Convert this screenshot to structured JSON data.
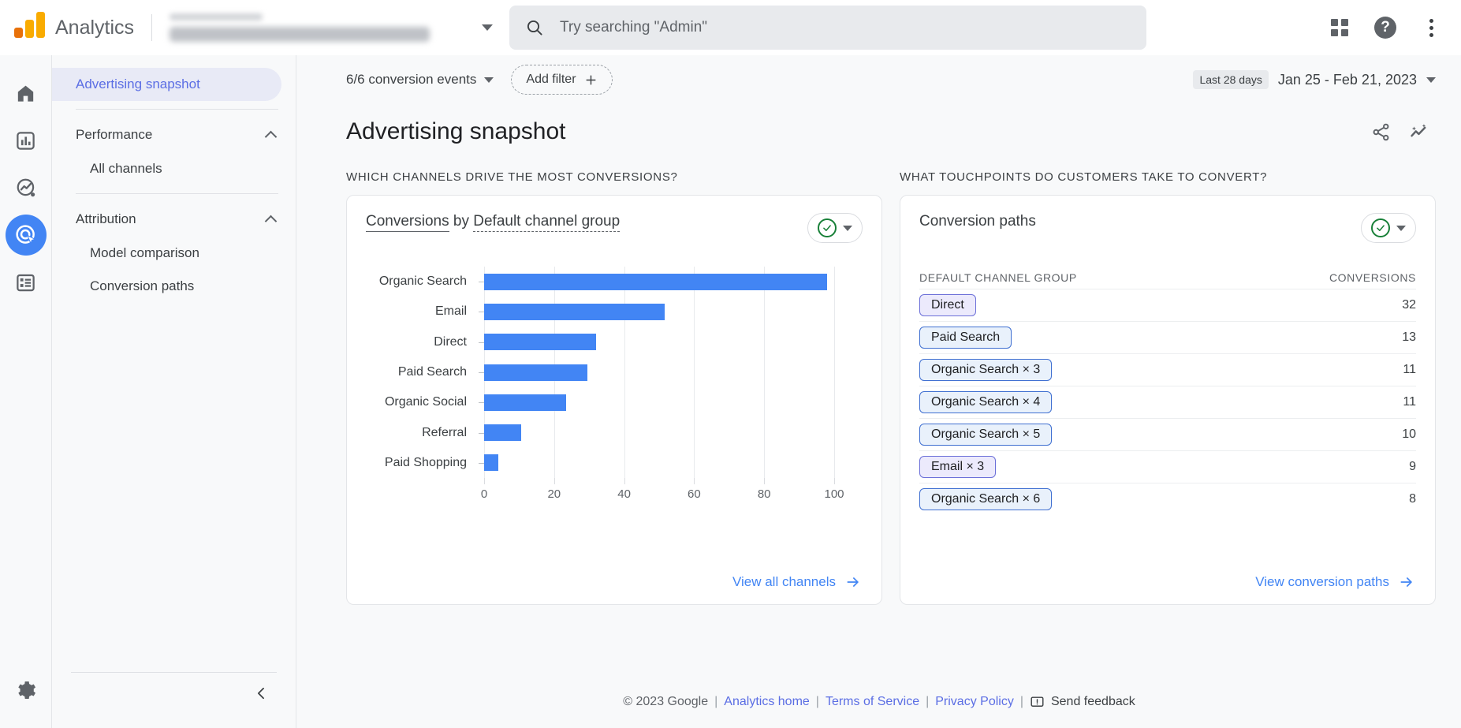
{
  "topbar": {
    "brand": "Analytics",
    "logo_icon": "analytics-logo-icon",
    "property_selector_icon": "chevron-down-icon",
    "search": {
      "placeholder": "Try searching \"Admin\"",
      "value": "",
      "icon": "search-icon"
    },
    "apps_icon": "apps-grid-icon",
    "help_icon": "help-icon",
    "help_glyph": "?",
    "more_icon": "more-vert-icon"
  },
  "rail": {
    "items": [
      {
        "icon": "home-icon",
        "label": "Home",
        "active": false
      },
      {
        "icon": "reports-bar-chart-icon",
        "label": "Reports",
        "active": false
      },
      {
        "icon": "explore-trending-icon",
        "label": "Explore",
        "active": false
      },
      {
        "icon": "advertising-target-icon",
        "label": "Advertising",
        "active": true
      },
      {
        "icon": "library-list-icon",
        "label": "Library",
        "active": false
      }
    ],
    "settings_icon": "gear-icon"
  },
  "sidebar": {
    "selected": "Advertising snapshot",
    "snapshot_label": "Advertising snapshot",
    "groups": [
      {
        "label": "Performance",
        "chevron": "chevron-up-icon",
        "items": [
          {
            "label": "All channels"
          }
        ]
      },
      {
        "label": "Attribution",
        "chevron": "chevron-up-icon",
        "items": [
          {
            "label": "Model comparison"
          },
          {
            "label": "Conversion paths"
          }
        ]
      }
    ],
    "collapse_icon": "chevron-left-icon"
  },
  "filterbar": {
    "conversion_events": "6/6 conversion events",
    "conversion_events_icon": "chevron-down-icon",
    "add_filter": "Add filter",
    "add_filter_icon": "plus-icon",
    "date_badge": "Last 28 days",
    "date_range": "Jan 25 - Feb 21, 2023",
    "date_icon": "chevron-down-icon"
  },
  "page": {
    "title": "Advertising snapshot",
    "share_icon": "share-icon",
    "insights_icon": "insights-sparkle-icon"
  },
  "left_card": {
    "section_heading": "Which channels drive the most conversions?",
    "title_metric": "Conversions",
    "title_by": "by",
    "title_dimension": "Default channel group",
    "metric_pill_icon": "check-circle-icon",
    "metric_pill_caret": "chevron-down-icon",
    "link_label": "View all channels",
    "link_icon": "arrow-right-icon"
  },
  "right_card": {
    "section_heading": "What touchpoints do customers take to convert?",
    "title": "Conversion paths",
    "metric_pill_icon": "check-circle-icon",
    "metric_pill_caret": "chevron-down-icon",
    "col_dimension": "Default channel group",
    "col_metric": "Conversions",
    "rows": [
      {
        "label": "Direct",
        "value": "32",
        "chip_style": "violet"
      },
      {
        "label": "Paid Search",
        "value": "13",
        "chip_style": "blue"
      },
      {
        "label": "Organic Search × 3",
        "value": "11",
        "chip_style": "blue"
      },
      {
        "label": "Organic Search × 4",
        "value": "11",
        "chip_style": "blue"
      },
      {
        "label": "Organic Search × 5",
        "value": "10",
        "chip_style": "blue"
      },
      {
        "label": "Email × 3",
        "value": "9",
        "chip_style": "violet"
      },
      {
        "label": "Organic Search × 6",
        "value": "8",
        "chip_style": "blue"
      }
    ],
    "link_label": "View conversion paths",
    "link_icon": "arrow-right-icon"
  },
  "footer": {
    "copyright": "© 2023 Google",
    "links": [
      "Analytics home",
      "Terms of Service",
      "Privacy Policy"
    ],
    "feedback": "Send feedback",
    "feedback_icon": "feedback-icon",
    "separator": "|"
  },
  "colors": {
    "accent_blue": "#4285f4",
    "bar_blue": "#4285f4",
    "link_blue": "#5b6ee4",
    "selected_nav_bg": "#e8eaf6",
    "green_check": "#188038",
    "chip_blue_border": "#3f6fd1",
    "chip_blue_fill": "#e9f1fb",
    "chip_violet_border": "#6b6fd8",
    "chip_violet_fill": "#eceafc",
    "page_bg": "#f8f9fa"
  },
  "chart_data": {
    "type": "bar",
    "orientation": "horizontal",
    "title": "Conversions by Default channel group",
    "xlabel": "",
    "ylabel": "",
    "categories": [
      "Organic Search",
      "Email",
      "Direct",
      "Paid Search",
      "Organic Social",
      "Referral",
      "Paid Shopping"
    ],
    "values": [
      98,
      51.5,
      32,
      29.5,
      23.5,
      10.5,
      4
    ],
    "xlim": [
      0,
      100
    ],
    "xticks": [
      0,
      20,
      40,
      60,
      80,
      100
    ],
    "grid": true,
    "legend": false,
    "series": [
      {
        "name": "Conversions",
        "values": [
          98,
          51.5,
          32,
          29.5,
          23.5,
          10.5,
          4
        ]
      }
    ]
  }
}
